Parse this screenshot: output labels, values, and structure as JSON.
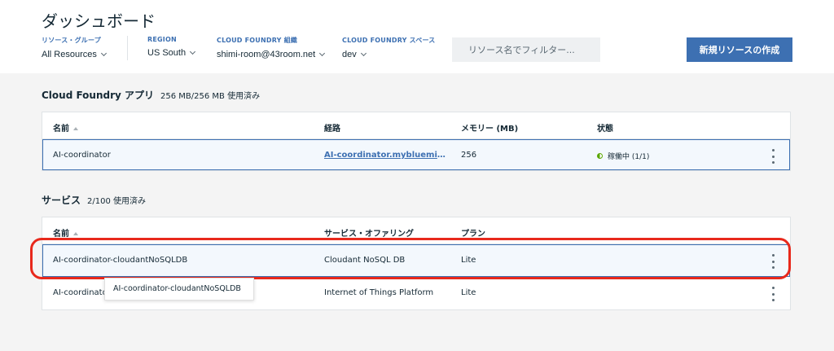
{
  "page": {
    "title": "ダッシュボード"
  },
  "filters": [
    {
      "label": "リソース・グループ",
      "value": "All Resources"
    },
    {
      "label": "REGION",
      "value": "US South"
    },
    {
      "label": "CLOUD FOUNDRY 組織",
      "value": "shimi-room@43room.net"
    },
    {
      "label": "CLOUD FOUNDRY スペース",
      "value": "dev"
    }
  ],
  "search": {
    "placeholder": "リソース名でフィルター..."
  },
  "create_button": {
    "label": "新規リソースの作成"
  },
  "apps": {
    "title": "Cloud Foundry アプリ",
    "usage": "256 MB/256 MB 使用済み",
    "columns": [
      "名前",
      "経路",
      "メモリー (MB)",
      "状態"
    ],
    "rows": [
      {
        "name": "AI-coordinator",
        "route": "AI-coordinator.mybluemix.net",
        "memory": "256",
        "status": "稼働中 (1/1)"
      }
    ]
  },
  "services": {
    "title": "サービス",
    "usage": "2/100 使用済み",
    "columns": [
      "名前",
      "サービス・オファリング",
      "プラン"
    ],
    "rows": [
      {
        "name": "AI-coordinator-cloudantNoSQLDB",
        "offering": "Cloudant NoSQL DB",
        "plan": "Lite"
      },
      {
        "name": "AI-coordinator-iotf-service",
        "offering": "Internet of Things Platform",
        "plan": "Lite"
      }
    ]
  },
  "tooltip": {
    "text": "AI-coordinator-cloudantNoSQLDB"
  },
  "colors": {
    "accent": "#3d70b2",
    "highlight": "#e8291c",
    "status_green": "#5aa700"
  }
}
